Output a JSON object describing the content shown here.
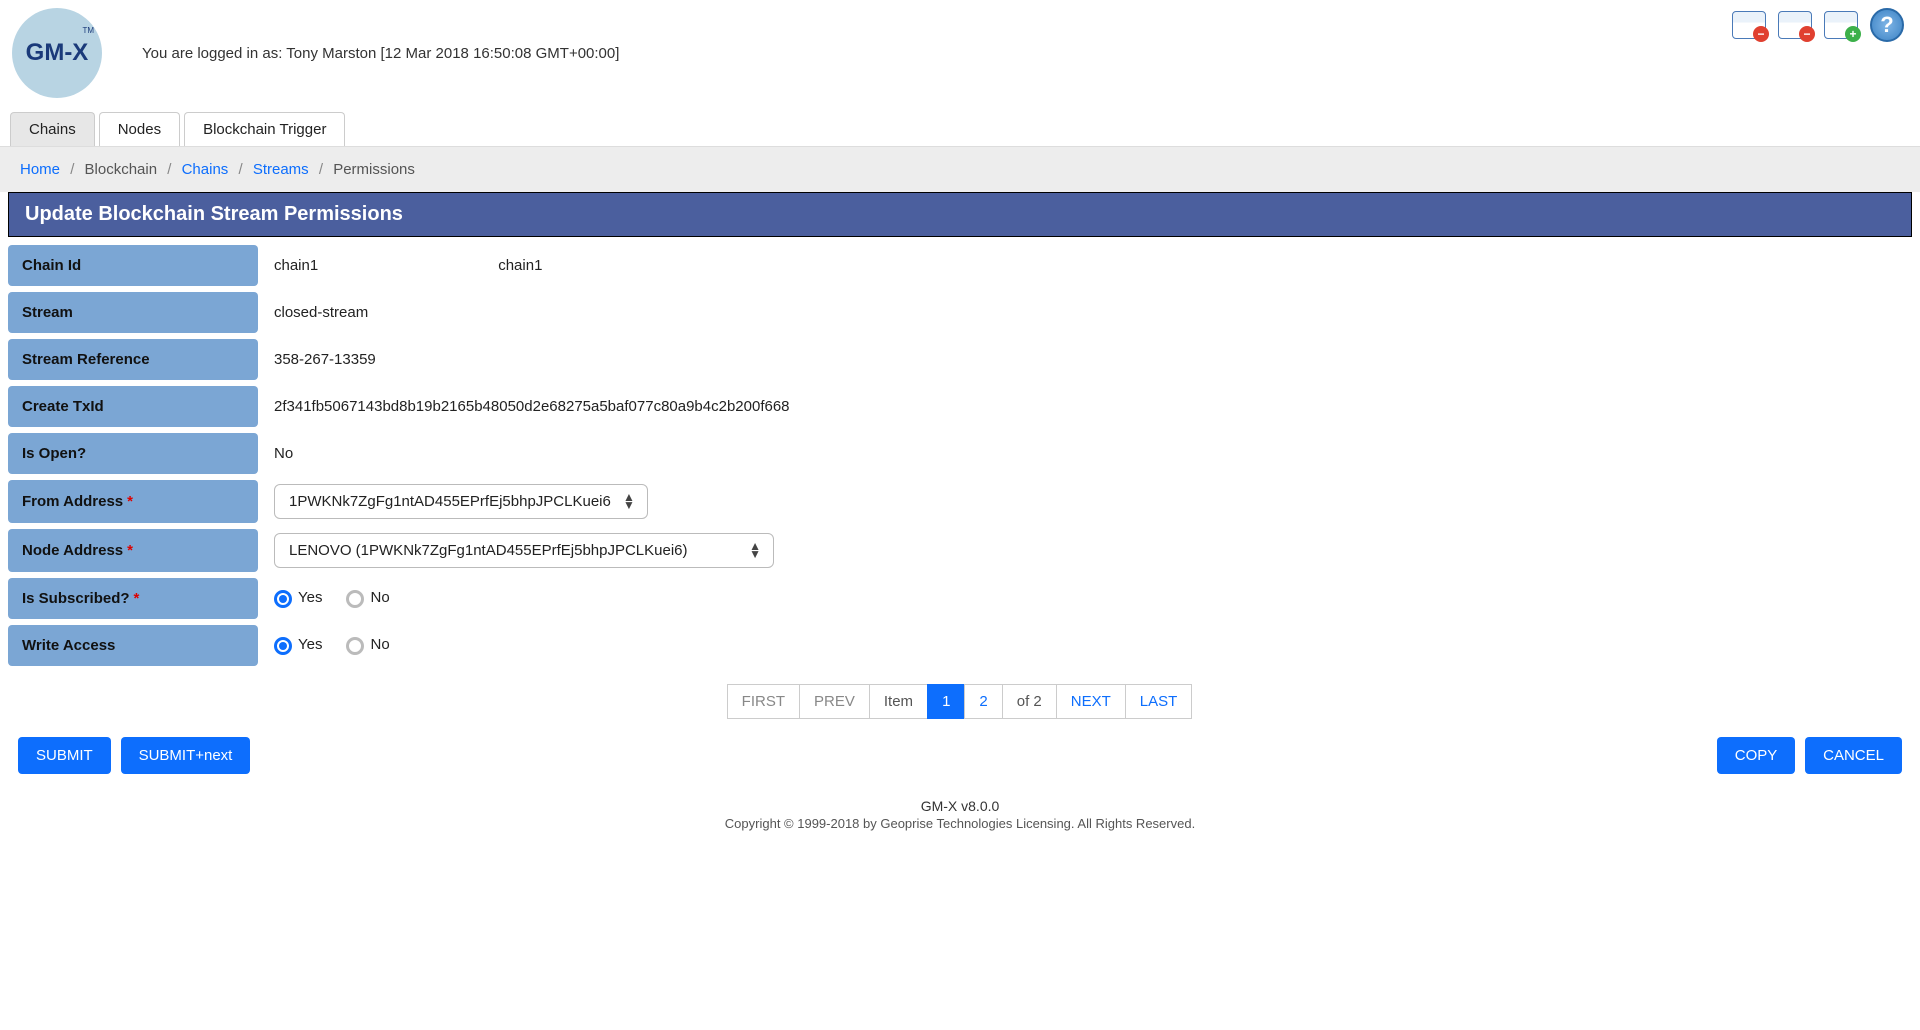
{
  "header": {
    "logo_text": "GM-X",
    "logo_tm": "TM",
    "login_prefix": "You are logged in as: ",
    "login_user": "Tony Marston",
    "login_timestamp": " [12 Mar 2018 16:50:08 GMT+00:00]"
  },
  "tabs": [
    {
      "label": "Chains",
      "active": true
    },
    {
      "label": "Nodes",
      "active": false
    },
    {
      "label": "Blockchain Trigger",
      "active": false
    }
  ],
  "breadcrumb": {
    "home": "Home",
    "blockchain": "Blockchain",
    "chains": "Chains",
    "streams": "Streams",
    "permissions": "Permissions"
  },
  "page_title": "Update Blockchain Stream Permissions",
  "form": {
    "chain_id_label": "Chain Id",
    "chain_id_value1": "chain1",
    "chain_id_value2": "chain1",
    "stream_label": "Stream",
    "stream_value": "closed-stream",
    "stream_ref_label": "Stream Reference",
    "stream_ref_value": "358-267-13359",
    "create_txid_label": "Create TxId",
    "create_txid_value": "2f341fb5067143bd8b19b2165b48050d2e68275a5baf077c80a9b4c2b200f668",
    "is_open_label": "Is Open?",
    "is_open_value": "No",
    "from_address_label": "From Address",
    "from_address_value": "1PWKNk7ZgFg1ntAD455EPrfEj5bhpJPCLKuei6",
    "node_address_label": "Node Address",
    "node_address_value": "LENOVO (1PWKNk7ZgFg1ntAD455EPrfEj5bhpJPCLKuei6)",
    "is_subscribed_label": "Is Subscribed?",
    "write_access_label": "Write Access",
    "radio_yes": "Yes",
    "radio_no": "No",
    "required_marker": "*"
  },
  "pagination": {
    "first": "FIRST",
    "prev": "PREV",
    "item": "Item",
    "p1": "1",
    "p2": "2",
    "of": "of 2",
    "next": "NEXT",
    "last": "LAST"
  },
  "actions": {
    "submit": "SUBMIT",
    "submit_next": "SUBMIT+next",
    "copy": "COPY",
    "cancel": "CANCEL"
  },
  "footer": {
    "version_line": "GM-X v8.0.0",
    "copyright": "Copyright © 1999-2018 by Geoprise Technologies Licensing. All Rights Reserved."
  }
}
